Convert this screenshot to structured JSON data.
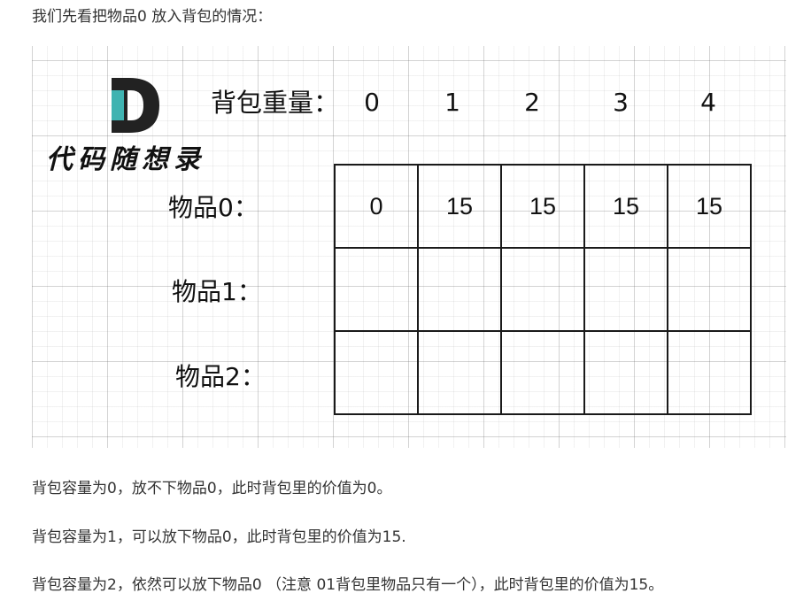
{
  "intro": "我们先看把物品0 放入背包的情况：",
  "figure": {
    "brand": "代码随想录",
    "capacity_label": "背包重量：",
    "capacities": [
      "0",
      "1",
      "2",
      "3",
      "4"
    ],
    "items": [
      {
        "label": "物品0：",
        "values": [
          "0",
          "15",
          "15",
          "15",
          "15"
        ]
      },
      {
        "label": "物品1：",
        "values": [
          "",
          "",
          "",
          "",
          ""
        ]
      },
      {
        "label": "物品2：",
        "values": [
          "",
          "",
          "",
          "",
          ""
        ]
      }
    ],
    "colors": {
      "logo_dark": "#222222",
      "logo_teal": "#3fb3b1",
      "grid": "#bdbdbd",
      "border": "#1a1a1a"
    },
    "icons": {
      "logo": "letter-d-logo"
    }
  },
  "paragraphs": [
    "背包容量为0，放不下物品0，此时背包里的价值为0。",
    "背包容量为1，可以放下物品0，此时背包里的价值为15.",
    "背包容量为2，依然可以放下物品0 （注意 01背包里物品只有一个），此时背包里的价值为15。"
  ]
}
